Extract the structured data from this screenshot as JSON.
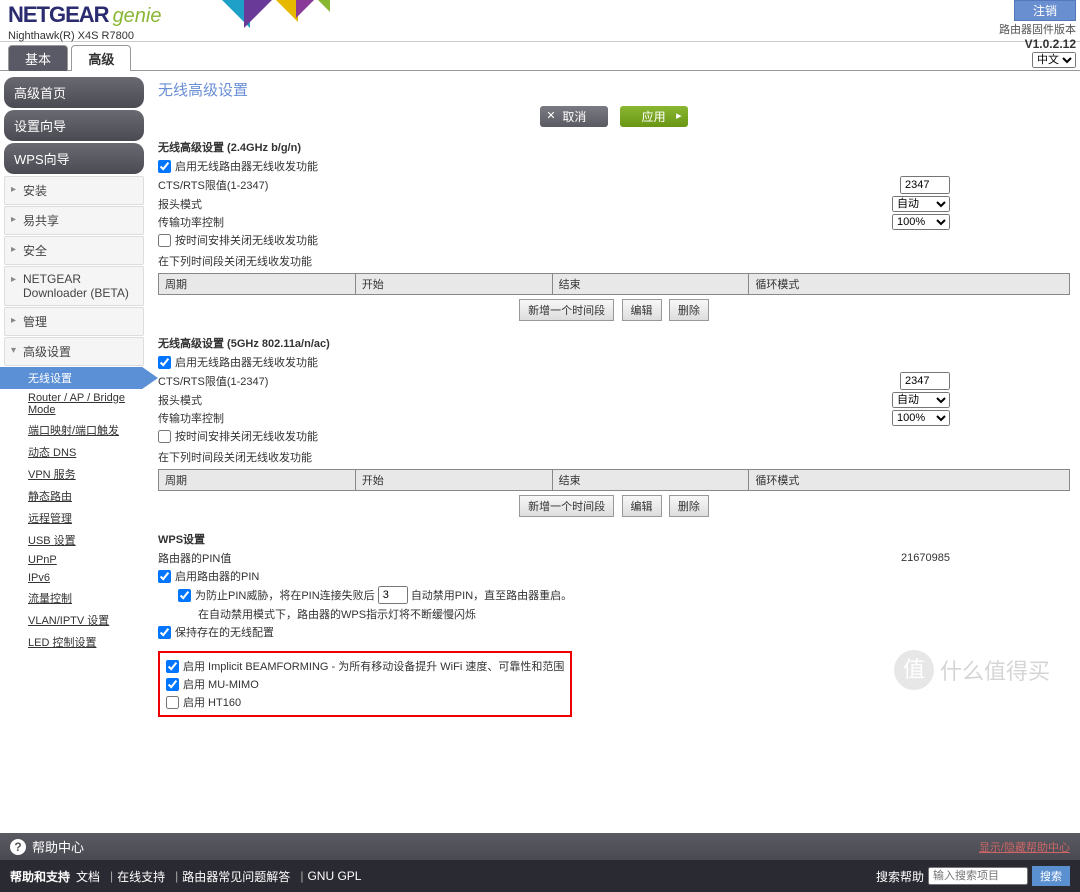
{
  "header": {
    "logo_main": "NETGEAR",
    "logo_sub": "genie",
    "model": "Nighthawk(R) X4S R7800",
    "logout": "注销",
    "fw_label": "路由器固件版本",
    "fw_version": "V1.0.2.12",
    "language": "中文"
  },
  "tabs": {
    "basic": "基本",
    "advanced": "高级"
  },
  "sidebar": {
    "home": "高级首页",
    "wizard": "设置向导",
    "wps": "WPS向导",
    "install": "安装",
    "share": "易共享",
    "security": "安全",
    "downloader": "NETGEAR Downloader (BETA)",
    "manage": "管理",
    "adv_settings": "高级设置",
    "subs": {
      "wireless": "无线设置",
      "router_mode": "Router / AP / Bridge Mode",
      "port": "端口映射/端口触发",
      "ddns": "动态 DNS",
      "vpn": "VPN 服务",
      "static_route": "静态路由",
      "remote": "远程管理",
      "usb": "USB 设置",
      "upnp": "UPnP",
      "ipv6": "IPv6",
      "traffic": "流量控制",
      "vlan": "VLAN/IPTV 设置",
      "led": "LED 控制设置"
    }
  },
  "content": {
    "title": "无线高级设置",
    "cancel": "取消",
    "apply": "应用",
    "band24": {
      "title": "无线高级设置 (2.4GHz b/g/n)",
      "enable_radio": "启用无线路由器无线收发功能",
      "cts_label": "CTS/RTS限值(1-2347)",
      "cts_value": "2347",
      "preamble": "报头模式",
      "preamble_val": "自动",
      "txpower": "传输功率控制",
      "txpower_val": "100%",
      "sched_off": "按时间安排关闭无线收发功能",
      "sched_label": "在下列时间段关闭无线收发功能"
    },
    "band5": {
      "title": "无线高级设置 (5GHz 802.11a/n/ac)",
      "enable_radio": "启用无线路由器无线收发功能",
      "cts_label": "CTS/RTS限值(1-2347)",
      "cts_value": "2347",
      "preamble": "报头模式",
      "preamble_val": "自动",
      "txpower": "传输功率控制",
      "txpower_val": "100%",
      "sched_off": "按时间安排关闭无线收发功能",
      "sched_label": "在下列时间段关闭无线收发功能"
    },
    "sched_cols": {
      "period": "周期",
      "start": "开始",
      "end": "结束",
      "recur": "循环模式"
    },
    "sched_btns": {
      "add": "新增一个时间段",
      "edit": "编辑",
      "del": "删除"
    },
    "wps": {
      "title": "WPS设置",
      "pin_label": "路由器的PIN值",
      "pin_value": "21670985",
      "enable_pin": "启用路由器的PIN",
      "pin_fail_prefix": "为防止PIN威胁，将在PIN连接失败后",
      "pin_fail_val": "3",
      "pin_fail_suffix": "自动禁用PIN，直至路由器重启。",
      "pin_note": "在自动禁用模式下，路由器的WPS指示灯将不断缓慢闪烁",
      "keep_config": "保持存在的无线配置"
    },
    "features": {
      "beamforming": "启用 Implicit BEAMFORMING - 为所有移动设备提升 WiFi 速度、可靠性和范围",
      "mumimo": "启用 MU-MIMO",
      "ht160": "启用 HT160"
    }
  },
  "helpbar": {
    "label": "帮助中心",
    "tip": "显示/隐藏帮助中心"
  },
  "footer": {
    "support": "帮助和支持",
    "doc": "文档",
    "online": "在线支持",
    "faq": "路由器常见问题解答",
    "gpl": "GNU GPL",
    "search_label": "搜索帮助",
    "search_placeholder": "输入搜索项目",
    "search_btn": "搜索"
  },
  "watermark": "什么值得买"
}
